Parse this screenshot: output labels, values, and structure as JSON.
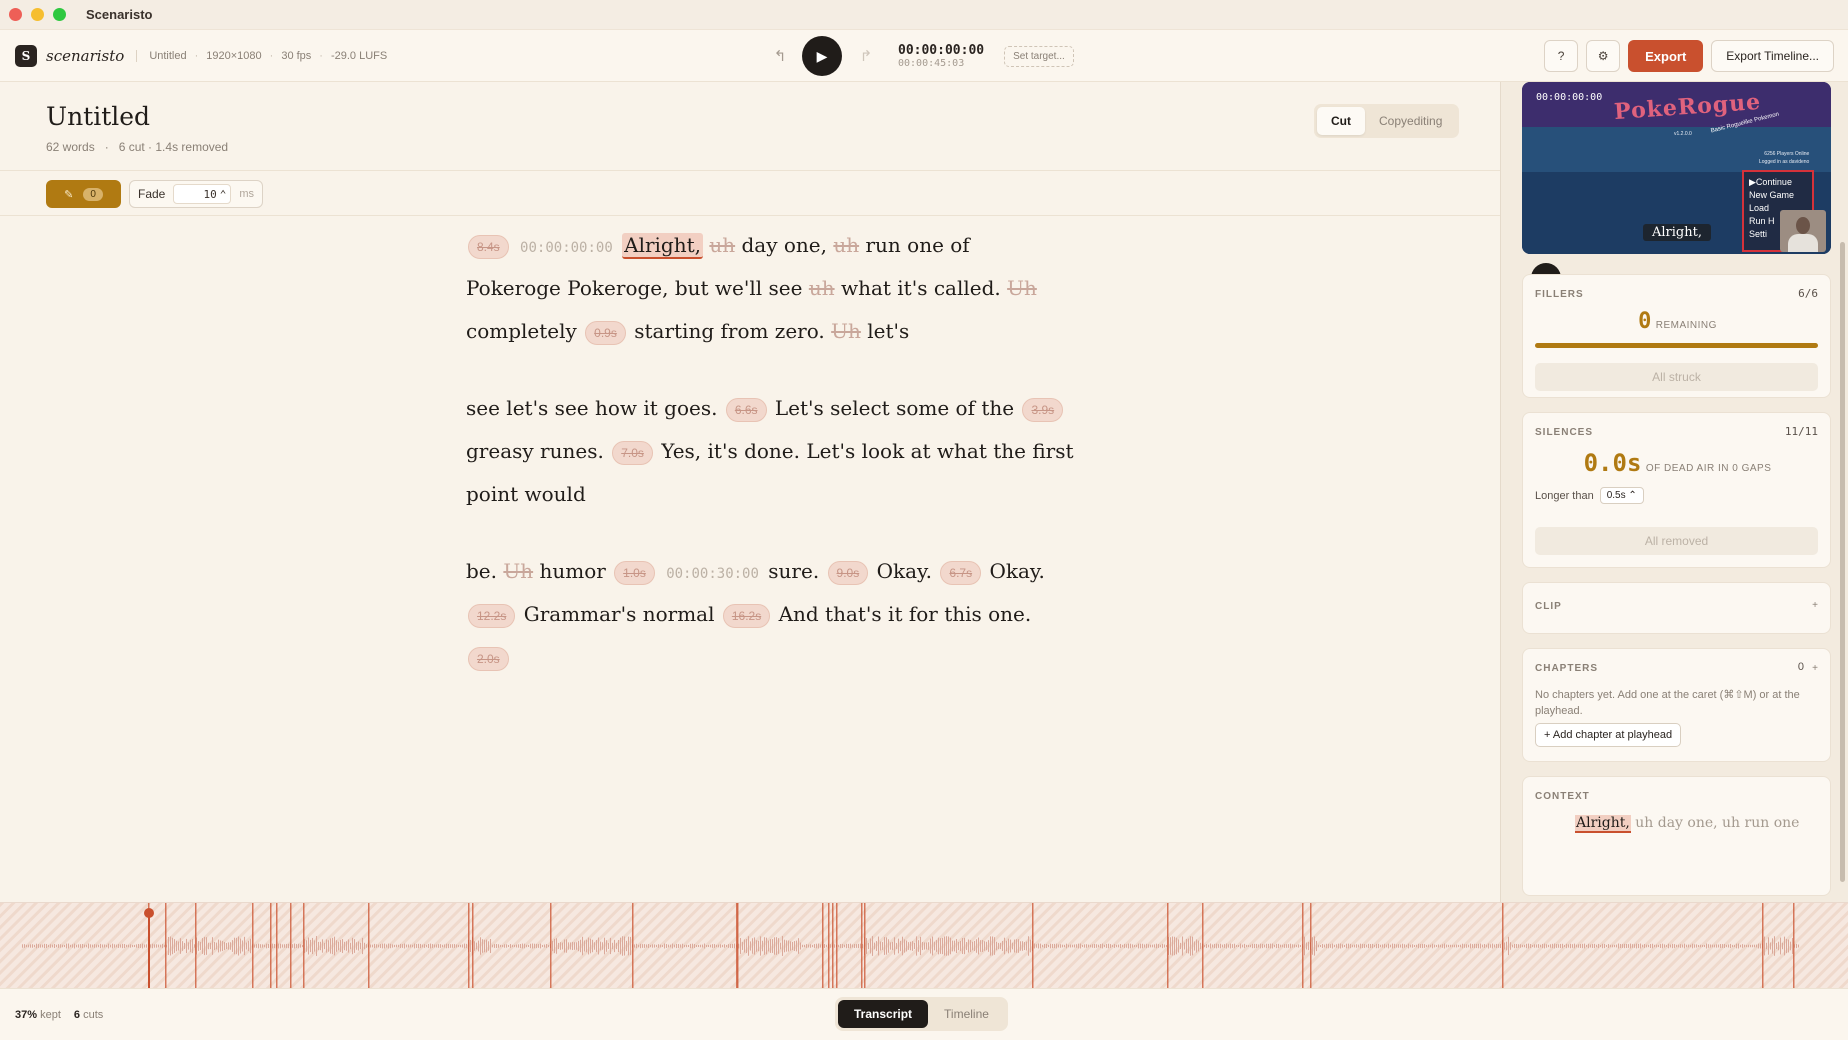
{
  "window": {
    "title": "Scenaristo"
  },
  "toolbar": {
    "logo_letter": "S",
    "logo_text": "scenaristo",
    "project": "Untitled",
    "resolution": "1920×1080",
    "fps": "30 fps",
    "loudness": "-29.0 LUFS",
    "play_icon": "▶",
    "undo_icon": "↰",
    "redo_icon": "↱",
    "timecode": "00:00:00:00",
    "duration": "00:00:45:03",
    "set_target": "Set target...",
    "help_label": "?",
    "settings_icon": "⚙",
    "export_label": "Export",
    "export_timeline_label": "Export Timeline..."
  },
  "doc": {
    "title": "Untitled",
    "words": "62 words",
    "cuts_removed": "6 cut · 1.4s removed",
    "mode_cut": "Cut",
    "mode_copyediting": "Copyediting",
    "filler_count": "0",
    "fade_label": "Fade",
    "fade_value": "10",
    "fade_unit": "ms"
  },
  "transcript": {
    "p1": {
      "l1": {
        "gap1": "8.4s",
        "ts1": "00:00:00:00",
        "w1": "Alright,",
        "f1": "uh",
        "w2": "day one,",
        "f2": "uh",
        "w3": "run one of"
      },
      "l2": {
        "w1": "Pokeroge Pokeroge, but we'll see",
        "f1": "uh",
        "w2": "what it's called.",
        "f2": "Uh"
      },
      "l3": {
        "w1": "completely",
        "gap1": "0.9s",
        "w2": "starting from zero.",
        "f1": "Uh",
        "w3": "let's"
      }
    },
    "p2": {
      "l1": {
        "w1": "see let's see how it goes.",
        "gap1": "6.6s",
        "w2": "Let's select some of the",
        "gap2": "3.9s"
      },
      "l2": {
        "w1": "greasy runes.",
        "gap1": "7.0s",
        "w2": "Yes, it's done. Let's look at what the first"
      },
      "l3": {
        "w1": "point would"
      }
    },
    "p3": {
      "l1": {
        "w1": "be.",
        "f1": "Uh",
        "w2": "humor",
        "gap1": "1.0s",
        "ts1": "00:00:30:00",
        "w3": "sure.",
        "gap2": "9.0s",
        "w4": "Okay.",
        "gap3": "6.7s",
        "w5": "Okay."
      },
      "l2": {
        "gap1": "12.2s",
        "w1": "Grammar's normal",
        "gap2": "16.2s",
        "w2": "And that's it for this one."
      },
      "l3": {
        "gap1": "2.0s"
      }
    }
  },
  "preview": {
    "timecode": "00:00:00:00",
    "game_logo": "PokeRogue",
    "game_sub": "Basic Roguelike Pokemon",
    "version": "v1.2.0.0",
    "players_online": "6256 Players Online",
    "logged_in": "Logged in as davideno",
    "menu": [
      "▶Continue",
      "New Game",
      "Load",
      "Run H",
      "Setti"
    ],
    "caption": "Alright,",
    "play_icon": "▶"
  },
  "fillers": {
    "header": "FILLERS",
    "count": "6/6",
    "remaining_value": "0",
    "remaining_label": "REMAINING",
    "progress": 1.0,
    "button": "All struck"
  },
  "silences": {
    "header": "SILENCES",
    "count": "11/11",
    "value": "0.0s",
    "label": "OF DEAD AIR IN 0 GAPS",
    "longer_label": "Longer than",
    "longer_value": "0.5s ⌃",
    "button": "All removed"
  },
  "clip": {
    "header": "CLIP",
    "plus": "+"
  },
  "chapters": {
    "header": "CHAPTERS",
    "count": "0",
    "plus": "+",
    "empty_text": "No chapters yet. Add one at the caret (⌘⇧M) or at the playhead.",
    "add_button": "+ Add chapter at playhead"
  },
  "context": {
    "header": "CONTEXT",
    "current": "Alright,",
    "rest": " uh day one, uh run one"
  },
  "status": {
    "kept_value": "37%",
    "kept_label": "kept",
    "cuts_value": "6",
    "cuts_label": "cuts",
    "tab_transcript": "Transcript",
    "tab_timeline": "Timeline"
  },
  "colors": {
    "accent": "#c9502e",
    "gold": "#b07a12",
    "background": "#f9f3ea"
  }
}
